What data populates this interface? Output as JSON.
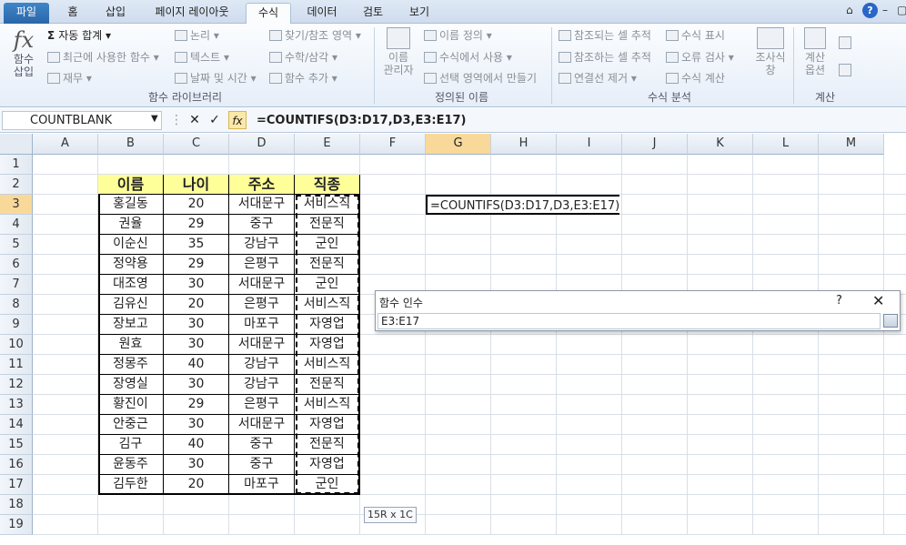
{
  "ribbon_tabs": [
    "파일",
    "홈",
    "삽입",
    "페이지 레이아웃",
    "수식",
    "데이터",
    "검토",
    "보기"
  ],
  "ribbon": {
    "function_library": {
      "insert_function": "함수\n삽입",
      "autosum": "자동 합계",
      "recent": "최근에 사용한 함수",
      "financial": "재무",
      "logical": "논리",
      "text": "텍스트",
      "datetime": "날짜 및 시간",
      "lookup": "찾기/참조 영역",
      "math": "수학/삼각",
      "more": "함수 추가",
      "group_label": "함수 라이브러리"
    },
    "defined_names": {
      "name_manager": "이름\n관리자",
      "define_name": "이름 정의",
      "use_in_formula": "수식에서 사용",
      "create_from_selection": "선택 영역에서 만들기",
      "group_label": "정의된 이름"
    },
    "formula_auditing": {
      "trace_precedents": "참조되는 셀 추적",
      "trace_dependents": "참조하는 셀 추적",
      "remove_arrows": "연결선 제거",
      "show_formulas": "수식 표시",
      "error_checking": "오류 검사",
      "evaluate_formula": "수식 계산",
      "watch_window": "조사식\n창",
      "group_label": "수식 분석"
    },
    "calculation": {
      "options": "계산\n옵션",
      "group_label": "계산"
    }
  },
  "formula_bar": {
    "name_box": "COUNTBLANK",
    "fx": "fx",
    "formula": "=COUNTIFS(D3:D17,D3,E3:E17)"
  },
  "columns": [
    "A",
    "B",
    "C",
    "D",
    "E",
    "F",
    "G",
    "H",
    "I",
    "J",
    "K",
    "L",
    "M"
  ],
  "rows": [
    "1",
    "2",
    "3",
    "4",
    "5",
    "6",
    "7",
    "8",
    "9",
    "10",
    "11",
    "12",
    "13",
    "14",
    "15",
    "16",
    "17",
    "18",
    "19"
  ],
  "table": {
    "headers": [
      "이름",
      "나이",
      "주소",
      "직종"
    ],
    "rows": [
      [
        "홍길동",
        "20",
        "서대문구",
        "서비스직"
      ],
      [
        "권율",
        "29",
        "중구",
        "전문직"
      ],
      [
        "이순신",
        "35",
        "강남구",
        "군인"
      ],
      [
        "정약용",
        "29",
        "은평구",
        "전문직"
      ],
      [
        "대조영",
        "30",
        "서대문구",
        "군인"
      ],
      [
        "김유신",
        "20",
        "은평구",
        "서비스직"
      ],
      [
        "장보고",
        "30",
        "마포구",
        "자영업"
      ],
      [
        "원효",
        "30",
        "서대문구",
        "자영업"
      ],
      [
        "정몽주",
        "40",
        "강남구",
        "서비스직"
      ],
      [
        "장영실",
        "30",
        "강남구",
        "전문직"
      ],
      [
        "황진이",
        "29",
        "은평구",
        "서비스직"
      ],
      [
        "안중근",
        "30",
        "서대문구",
        "자영업"
      ],
      [
        "김구",
        "40",
        "중구",
        "전문직"
      ],
      [
        "윤동주",
        "30",
        "중구",
        "자영업"
      ],
      [
        "김두한",
        "20",
        "마포구",
        "군인"
      ]
    ]
  },
  "cell_g3": "=COUNTIFS(D3:D17,D3,E3:E17)",
  "dialog": {
    "title": "함수 인수",
    "help": "?",
    "close": "✕",
    "value": "E3:E17"
  },
  "range_tip": "15R x 1C"
}
